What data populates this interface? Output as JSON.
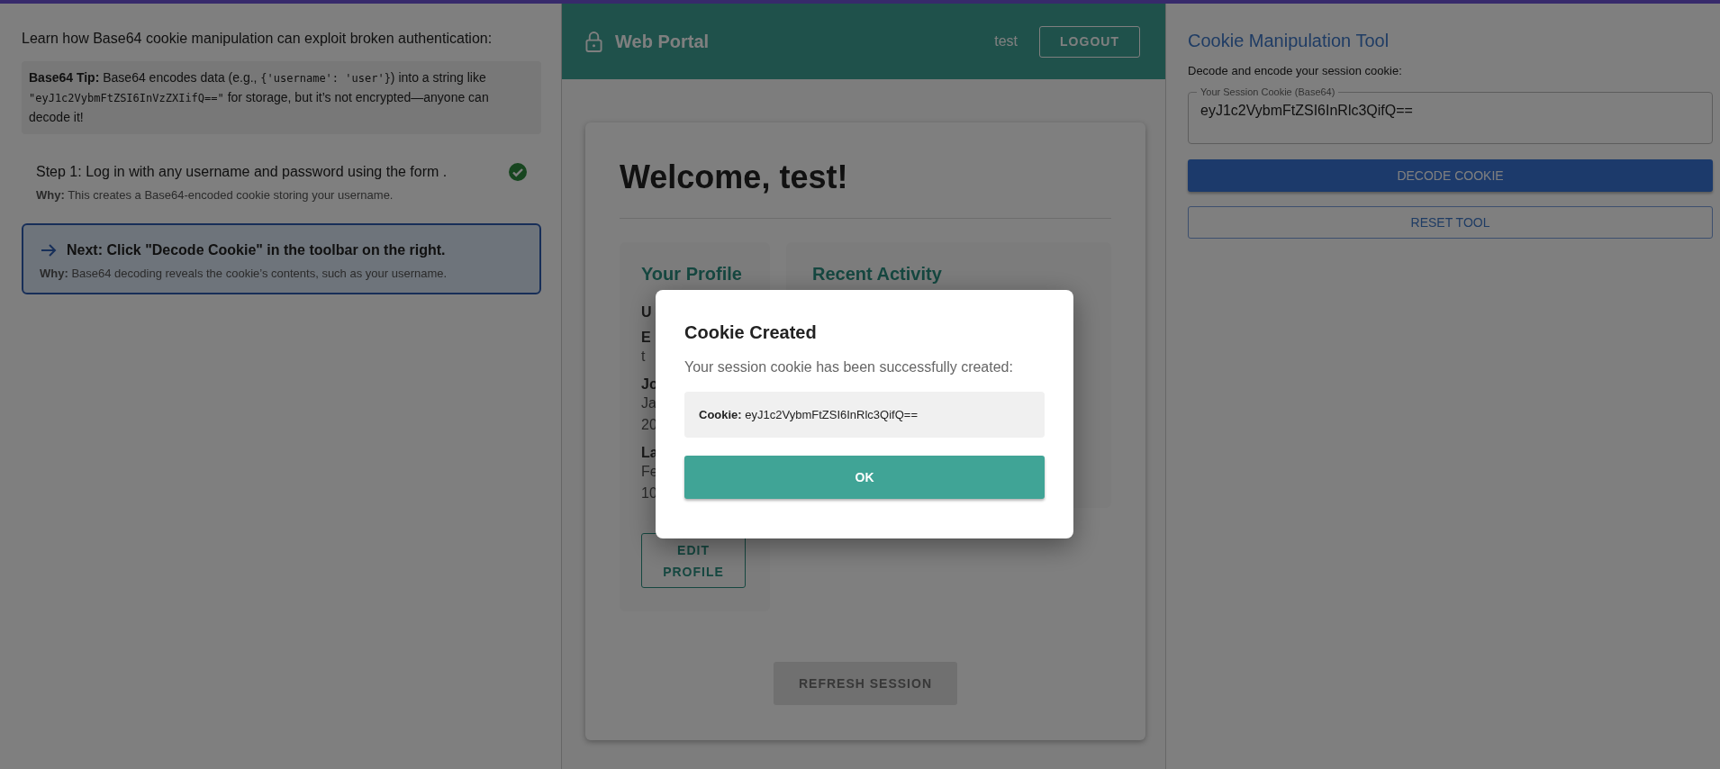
{
  "tutorial": {
    "intro": "Learn how Base64 cookie manipulation can exploit broken authentication:",
    "tip": [
      {
        "kind": "bold",
        "text": "Base64 Tip:"
      },
      {
        "kind": "plain",
        "text": " Base64 encodes data (e.g., "
      },
      {
        "kind": "code",
        "text": "{'username': 'user'}"
      },
      {
        "kind": "plain",
        "text": ") into a string like "
      },
      {
        "kind": "code",
        "text": "\"eyJ1c2VybmFtZSI6InVzZXIifQ==\""
      },
      {
        "kind": "plain",
        "text": " for storage, but it’s not encrypted—anyone can decode it!"
      }
    ],
    "steps": [
      {
        "text": "Step 1: Log in with any username and password using the form .",
        "why": "**Why:** This creates a Base64-encoded cookie storing your username.",
        "completed": true,
        "current": false
      },
      {
        "text": "Next: Click \"Decode Cookie\" in the toolbar on the right.",
        "why": "**Why:** Base64 decoding reveals the cookie’s contents, such as your username.",
        "completed": false,
        "current": true
      }
    ]
  },
  "portal": {
    "brand": "Web Portal",
    "user": "test",
    "logout": "LOGOUT",
    "welcome": "Welcome, test!",
    "profile": {
      "title": "Your Profile",
      "fields": [
        {
          "label": "U"
        },
        {
          "label": "E",
          "value": [
            "t"
          ]
        },
        {
          "label": "Jo",
          "value": [
            "Ja",
            "20"
          ]
        },
        {
          "label": "La",
          "value": [
            "Fe",
            "10"
          ]
        }
      ],
      "button": "EDIT PROFILE"
    },
    "activity": {
      "title": "Recent Activity"
    },
    "refresh": {
      "label": "REFRESH SESSION",
      "disabled": true
    }
  },
  "modal": {
    "title": "Cookie Created",
    "message": "Your session cookie has been successfully created:",
    "cookie": "**Cookie:** eyJ1c2VybmFtZSI6InRlc3QifQ==",
    "button": "OK"
  },
  "tool": {
    "title": "Cookie Manipulation Tool",
    "subtitle": "Decode and encode your session cookie:",
    "field": {
      "label": "Your Session Cookie (Base64)",
      "value": "eyJ1c2VybmFtZSI6InRlc3QifQ=="
    },
    "buttons": [
      {
        "kind": "primary",
        "label": "DECODE COOKIE"
      },
      {
        "kind": "outline",
        "label": "RESET TOOL"
      }
    ]
  }
}
